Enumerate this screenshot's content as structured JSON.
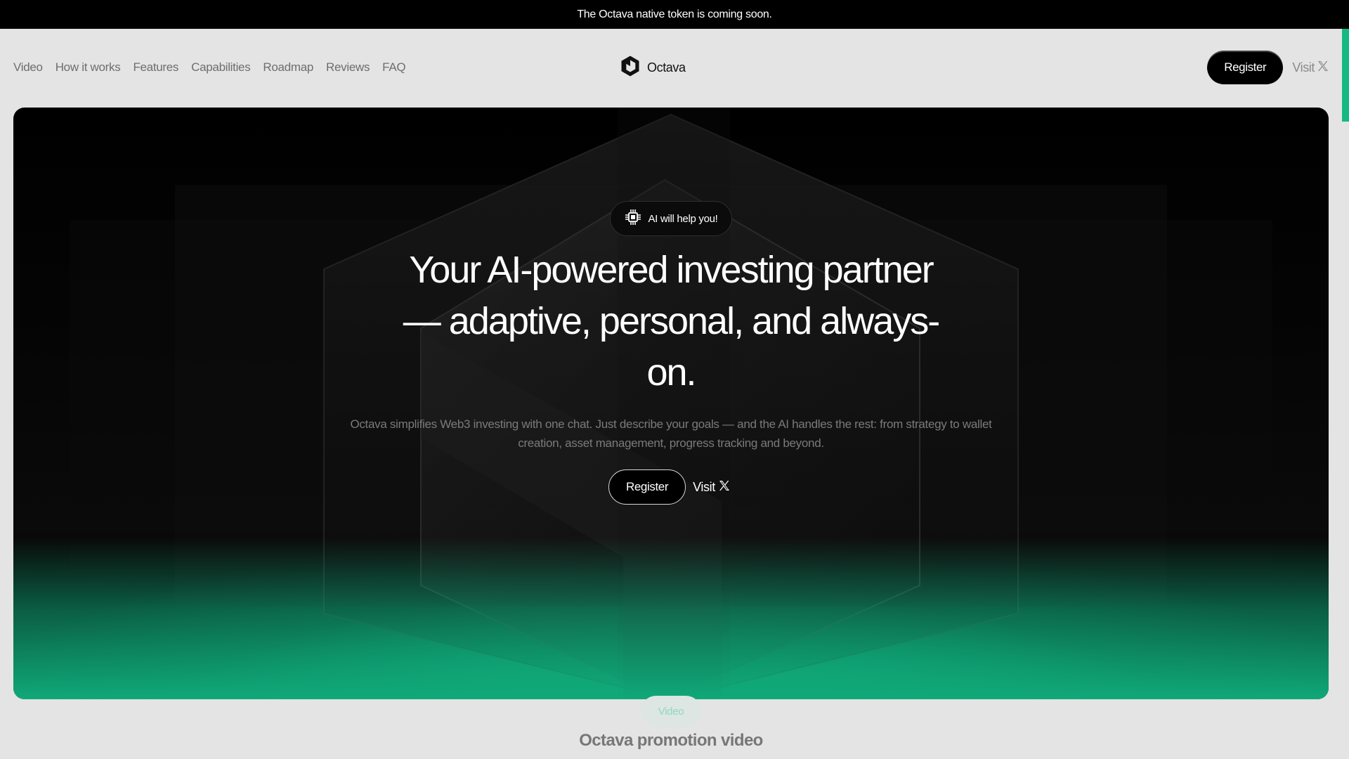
{
  "announcement": "The Octava native token is coming soon.",
  "nav": {
    "links": [
      "Video",
      "How it works",
      "Features",
      "Capabilities",
      "Roadmap",
      "Reviews",
      "FAQ"
    ],
    "brand": "Octava",
    "register_label": "Register",
    "visit_label": "Visit"
  },
  "hero": {
    "badge": "AI will help you!",
    "headline": "Your AI-powered investing partner — adaptive, personal, and always-on.",
    "subtext": "Octava simplifies Web3 investing with one chat. Just describe your goals — and the AI handles the rest: from strategy to wallet creation, asset management, progress tracking and beyond.",
    "register_label": "Register",
    "visit_label": "Visit"
  },
  "video_section": {
    "badge": "Video",
    "title": "Octava promotion video"
  },
  "icons": {
    "brand": "octava-hexagon-logo-icon",
    "x": "x-logo-icon",
    "badge": "cpu-chip-icon"
  },
  "colors": {
    "accent": "#10a878",
    "background": "#e4e4e4",
    "dark": "#000000"
  }
}
